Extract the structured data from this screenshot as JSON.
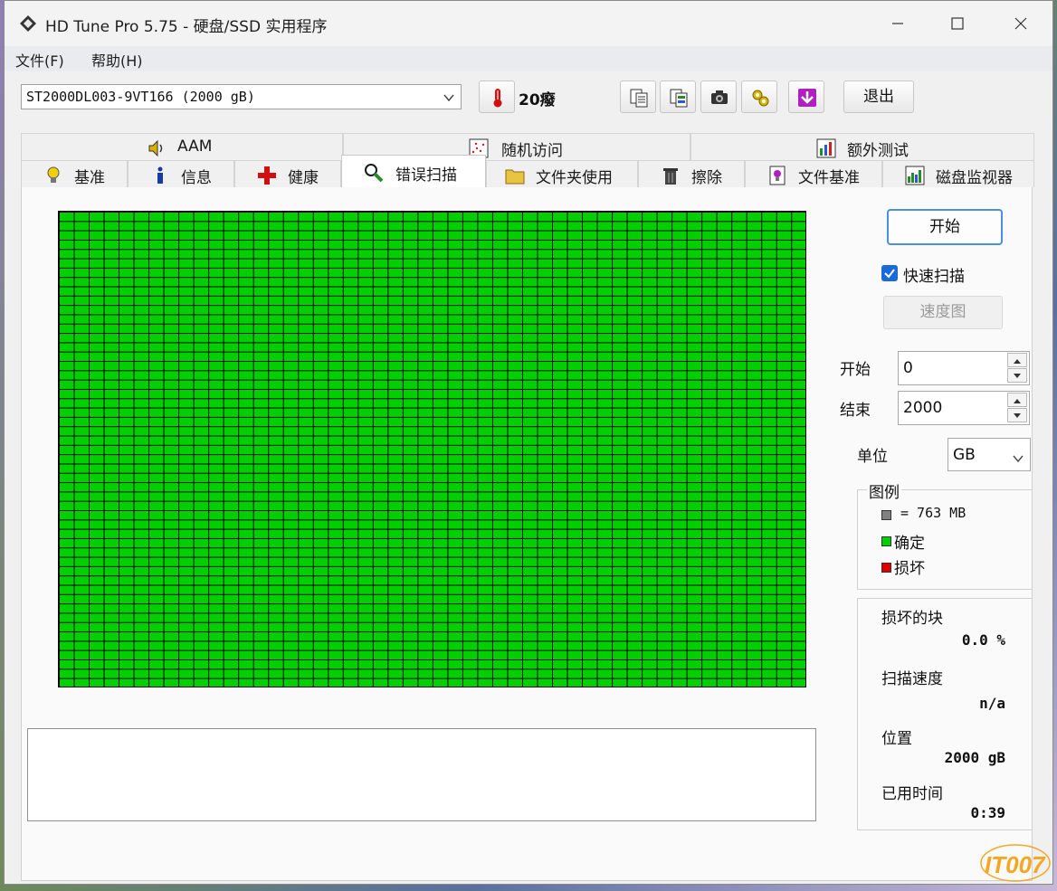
{
  "window": {
    "title": "HD Tune Pro 5.75 - 硬盘/SSD 实用程序"
  },
  "menu": {
    "items": [
      "文件(F)",
      "帮助(H)"
    ]
  },
  "toolbar": {
    "drive": "ST2000DL003-9VT166 (2000 gB)",
    "temperature": "20癈",
    "exit_label": "退出",
    "icons": [
      "thermometer-icon",
      "copy-text-icon",
      "copy-info-icon",
      "screenshot-icon",
      "options-icon",
      "save-icon"
    ]
  },
  "tabs": {
    "row1": [
      "AAM",
      "随机访问",
      "额外测试"
    ],
    "row2": [
      "基准",
      "信息",
      "健康",
      "错误扫描",
      "文件夹使用",
      "擦除",
      "文件基准",
      "磁盘监视器"
    ],
    "active": "错误扫描"
  },
  "scan": {
    "start_label": "开始",
    "quick_scan_label": "快速扫描",
    "quick_scan_checked": true,
    "speed_map_label": "速度图",
    "start_field_label": "开始",
    "start_value": "0",
    "end_field_label": "结束",
    "end_value": "2000",
    "unit_label": "单位",
    "unit_value": "GB"
  },
  "legend": {
    "title": "图例",
    "block_size": "= 763 MB",
    "ok_label": "确定",
    "bad_label": "损坏",
    "colors": {
      "unscanned": "#808080",
      "ok": "#00d000",
      "bad": "#e00000"
    }
  },
  "stats": {
    "damaged_label": "损坏的块",
    "damaged_value": "0.0 %",
    "speed_label": "扫描速度",
    "speed_value": "n/a",
    "position_label": "位置",
    "position_value": "2000 gB",
    "elapsed_label": "已用时间",
    "elapsed_value": "0:39"
  },
  "watermark": "IT007"
}
